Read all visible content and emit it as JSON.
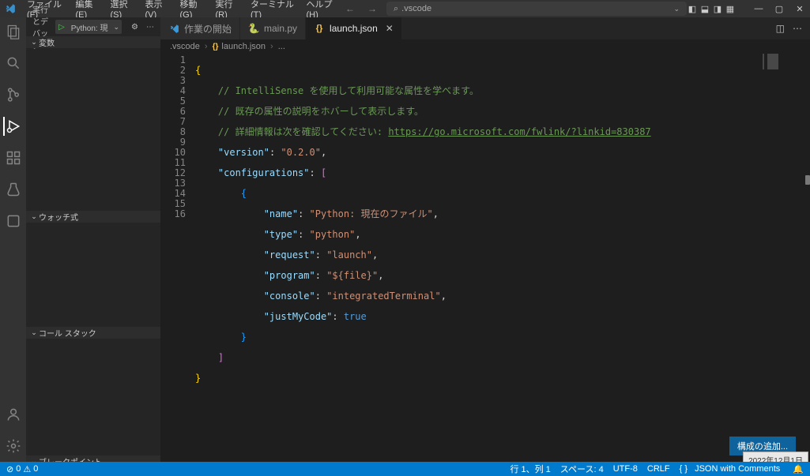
{
  "menus": {
    "file": "ファイル(F)",
    "edit": "編集(E)",
    "select": "選択(S)",
    "view": "表示(V)",
    "move": "移動(G)",
    "run": "実行(R)",
    "terminal": "ターミナル(T)",
    "help": "ヘルプ(H)"
  },
  "search_placeholder": ".vscode",
  "sidebar": {
    "title": "実行とデバッグ",
    "config_name": "Python: 現",
    "sections": {
      "variables": "変数",
      "watch": "ウォッチ式",
      "callstack": "コール スタック",
      "breakpoints": "ブレークポイント"
    }
  },
  "tabs": [
    {
      "label": "作業の開始",
      "icon": "vs"
    },
    {
      "label": "main.py",
      "icon": "py"
    },
    {
      "label": "launch.json",
      "icon": "json",
      "active": true
    }
  ],
  "breadcrumbs": {
    "folder": ".vscode",
    "file": "launch.json",
    "part": "..."
  },
  "code": {
    "lines": [
      1,
      2,
      3,
      4,
      5,
      6,
      7,
      8,
      9,
      10,
      11,
      12,
      13,
      14,
      15,
      16
    ],
    "comment1": "// IntelliSense を使用して利用可能な属性を学べます。",
    "comment2": "// 既存の属性の説明をホバーして表示します。",
    "comment3_pre": "// 詳細情報は次を確認してください: ",
    "comment3_link": "https://go.microsoft.com/fwlink/?linkid=830387",
    "k_version": "\"version\"",
    "v_version": "\"0.2.0\"",
    "k_configs": "\"configurations\"",
    "k_name": "\"name\"",
    "v_name": "\"Python: 現在のファイル\"",
    "k_type": "\"type\"",
    "v_type": "\"python\"",
    "k_request": "\"request\"",
    "v_request": "\"launch\"",
    "k_program": "\"program\"",
    "v_program": "\"${file}\"",
    "k_console": "\"console\"",
    "v_console": "\"integratedTerminal\"",
    "k_jmc": "\"justMyCode\"",
    "v_true": "true"
  },
  "add_config_button": "構成の追加...",
  "tooltip": "2022年12月1日",
  "status": {
    "errors": "0",
    "warnings": "0",
    "lncol": "行 1、列 1",
    "spaces": "スペース: 4",
    "encoding": "UTF-8",
    "eol": "CRLF",
    "lang_icon": "{ }",
    "lang": "JSON with Comments"
  }
}
